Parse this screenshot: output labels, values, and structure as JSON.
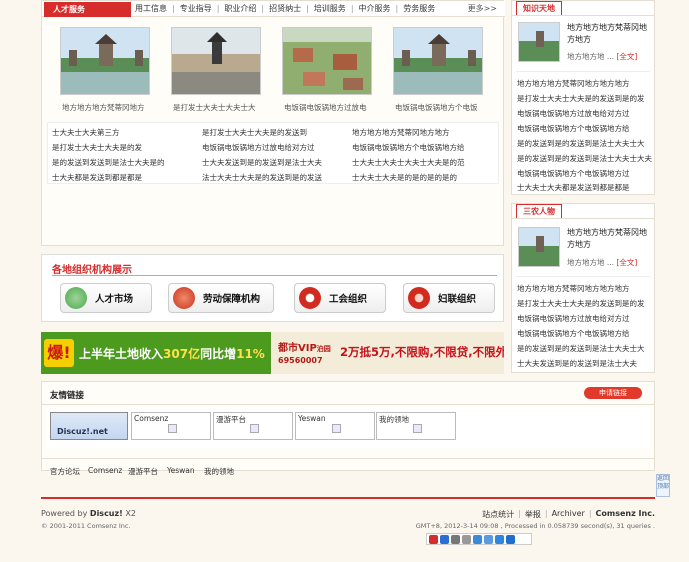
{
  "talent": {
    "title": "人才服务",
    "nav": [
      "用工信息",
      "专业指导",
      "职业介绍",
      "招贤纳士",
      "培训服务",
      "中介服务",
      "劳务服务"
    ],
    "more": "更多>>",
    "photos": [
      {
        "caption": "地方地方地方梵蒂冈地方"
      },
      {
        "caption": "是打发士大夫士大夫士大"
      },
      {
        "caption": "电饭锅电饭锅地方过放电"
      },
      {
        "caption": "电饭锅电饭锅地方个电饭"
      }
    ],
    "news": [
      [
        "士大夫士大夫第三方",
        "是打发士大夫士大夫是的发送到",
        "地方地方地方梵蒂冈地方地方"
      ],
      [
        "是打发士大夫士大夫是的发",
        "电饭锅电饭锅地方过放电给对方过",
        "电饭锅电饭锅地方个电饭锅地方给"
      ],
      [
        "是的发送到发送到是法士大夫是的",
        "士大夫发送到是的发送到是法士大夫",
        "士大夫士大夫士大夫士大夫是的范"
      ],
      [
        "士大夫都是发送到都是都是",
        "法士大夫士大夫是的发送到是的发送",
        "士大夫士大夫是的是的是的是的"
      ]
    ]
  },
  "knowledge": {
    "tab": "知识天地",
    "feature": {
      "title": "地方地方地方梵蒂冈地方地方",
      "summary": "地方地方地 ...",
      "link": "[全文]"
    },
    "lines": [
      "地方地方地方梵蒂冈地方地方地方",
      "是打发士大夫士大夫是的发送到是的发",
      "电饭锅电饭锅地方过放电给对方过",
      "电饭锅电饭锅地方个电饭锅地方给",
      "是的发送到是的发送到是法士大夫士大",
      "是的发送到是的发送到是法士大夫士大夫",
      "电饭锅电饭锅地方个电饭锅地方过",
      "士大夫士大夫都是发送到都是都是"
    ]
  },
  "agri": {
    "tab": "三农人物",
    "feature": {
      "title": "地方地方地方梵蒂冈地方地方",
      "summary": "地方地方地 ...",
      "link": "[全文]"
    },
    "lines": [
      "地方地方地方梵蒂冈地方地方地方",
      "是打发士大夫士大夫是的发送到是的发",
      "电饭锅电饭锅地方过放电给对方过",
      "电饭锅电饭锅地方个电饭锅地方给",
      "是的发送到是的发送到是法士大夫士大",
      "士大夫发送到是的发送到是法士大夫"
    ]
  },
  "orgs": {
    "title": "各地组织机构展示",
    "items": [
      {
        "label": "人才市场"
      },
      {
        "label": "劳动保障机构"
      },
      {
        "label": "工会组织"
      },
      {
        "label": "妇联组织"
      }
    ]
  },
  "ads": {
    "ad1": {
      "text1": "爆!",
      "text2": "上半年土地收入",
      "num": "307亿",
      "text3": "同比增",
      "pct": "11%"
    },
    "ad2": {
      "brand": "都市VIP",
      "sub": "泊园",
      "phone": "69560007",
      "promo": "2万抵5万,不限购,不限贷,不限外"
    }
  },
  "friendlinks": {
    "title": "友情链接",
    "apply": "申请链接",
    "logo": "Discuz!.net",
    "cards": [
      "Comsenz",
      "漫游平台",
      "Yeswan",
      "我的领地"
    ],
    "textlinks": [
      "官方论坛",
      "Comsenz",
      "漫游平台",
      "Yeswan",
      "我的领地"
    ]
  },
  "footer": {
    "powered_prefix": "Powered by",
    "powered_brand": "Discuz!",
    "powered_ver": "X2",
    "copyright": "© 2001-2011 Comsenz Inc.",
    "links": [
      "站点统计",
      "举报",
      "Archiver",
      "Comsenz Inc."
    ],
    "gmt": "GMT+8, 2012-3-14 09:08 , Processed in 0.058739 second(s), 31 queries .",
    "totop": "返回顶部"
  }
}
